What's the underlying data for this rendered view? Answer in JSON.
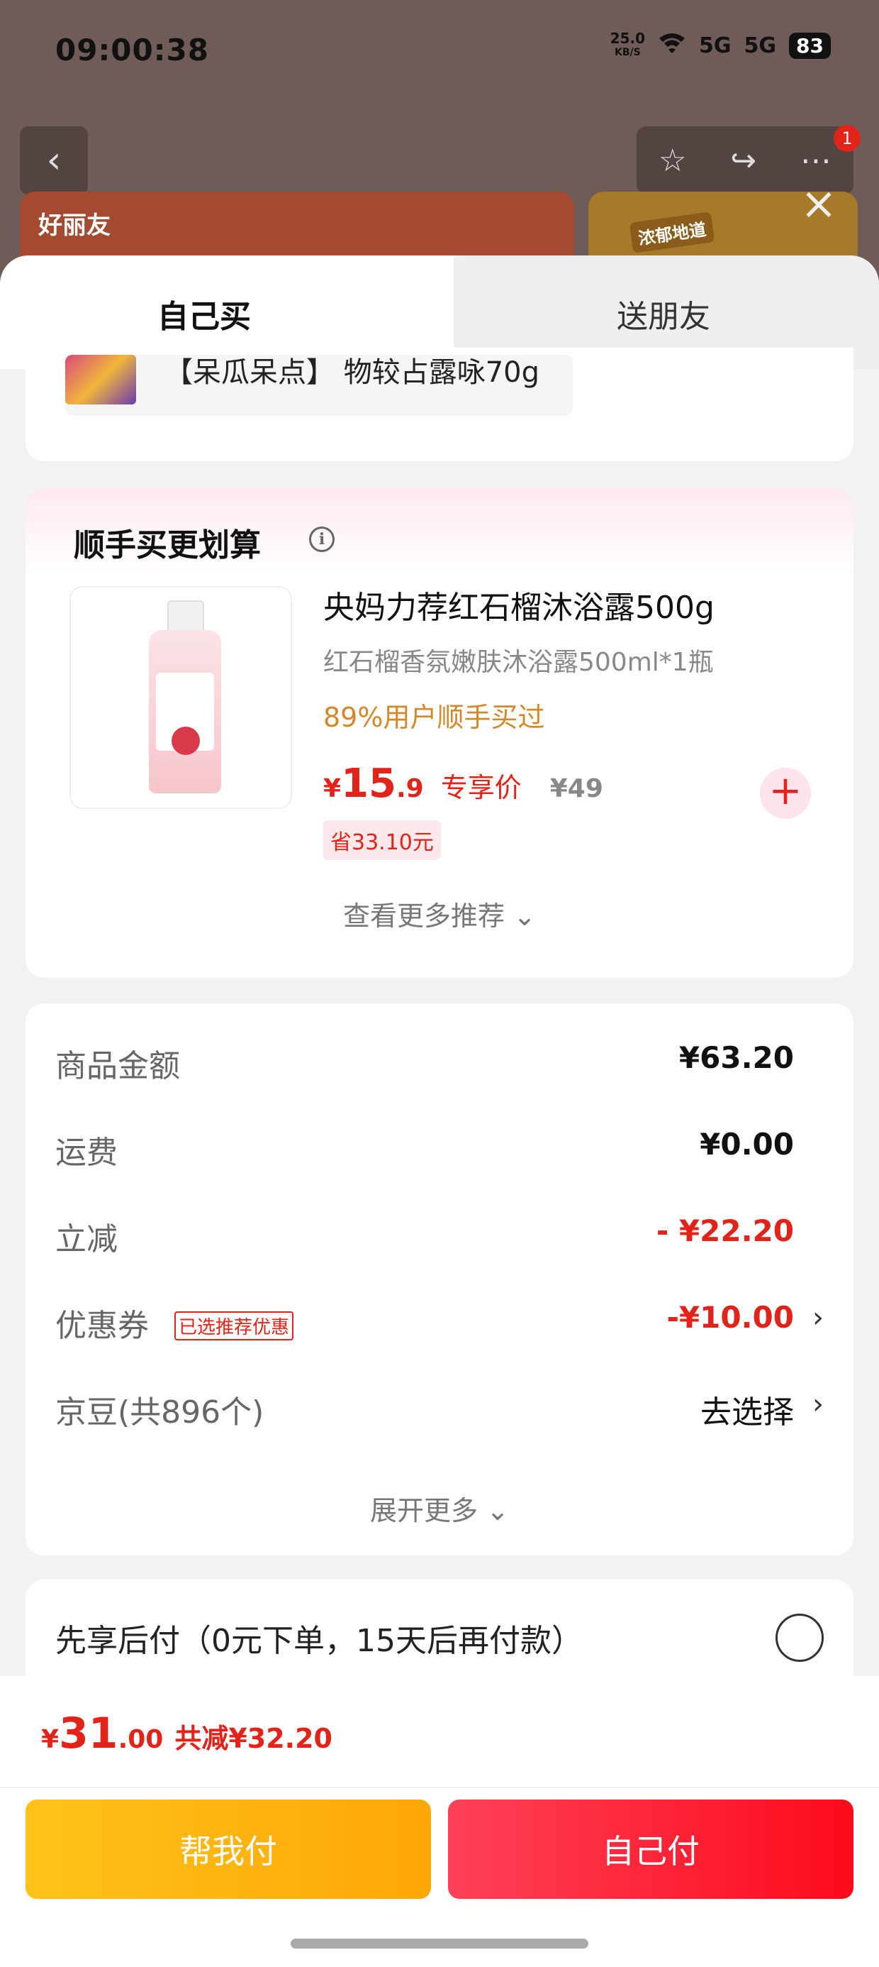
{
  "status": {
    "time": "09:00:38",
    "net_speed": "25.0",
    "net_unit": "KB/S",
    "signal1": "5G",
    "signal2": "5G",
    "battery": "83"
  },
  "header": {
    "back_icon": "chevron-left-icon",
    "badge_count": "1",
    "banner1_logo": "好丽友",
    "banner2_tag": "浓郁地道"
  },
  "tabs": {
    "self": "自己买",
    "friend": "送朋友"
  },
  "previous_item": {
    "name": "【呆瓜呆点】 物较占露咏70g"
  },
  "recommend": {
    "title": "顺手买更划算",
    "product": {
      "name": "央妈力荐红石榴沐浴露500g",
      "subtitle": "红石榴香氛嫩肤沐浴露500ml*1瓶",
      "note": "89%用户顺手买过",
      "price_symbol": "¥",
      "price_int": "15",
      "price_dec": ".9",
      "price_tag": "专享价",
      "original_price": "¥49",
      "save": "省33.10元"
    },
    "more": "查看更多推荐 ⌄"
  },
  "summary": {
    "goods_label": "商品金额",
    "goods_value": "¥63.20",
    "shipping_label": "运费",
    "shipping_value": "¥0.00",
    "discount_label": "立减",
    "discount_value": "- ¥22.20",
    "coupon_label": "优惠券",
    "coupon_tag": "已选推荐优惠",
    "coupon_value": "-¥10.00",
    "beans_label": "京豆(共896个)",
    "beans_value": "去选择",
    "expand": "展开更多 ⌄"
  },
  "pay_later": {
    "label": "先享后付（0元下单，15天后再付款）"
  },
  "bottom": {
    "total_symbol": "¥",
    "total_int": "31",
    "total_dec": ".00",
    "total_save": "共减¥32.20",
    "help_pay": "帮我付",
    "self_pay": "自己付"
  },
  "colors": {
    "accent": "#e2231a",
    "help": "#ffb812",
    "self": "#fd2a3c"
  }
}
